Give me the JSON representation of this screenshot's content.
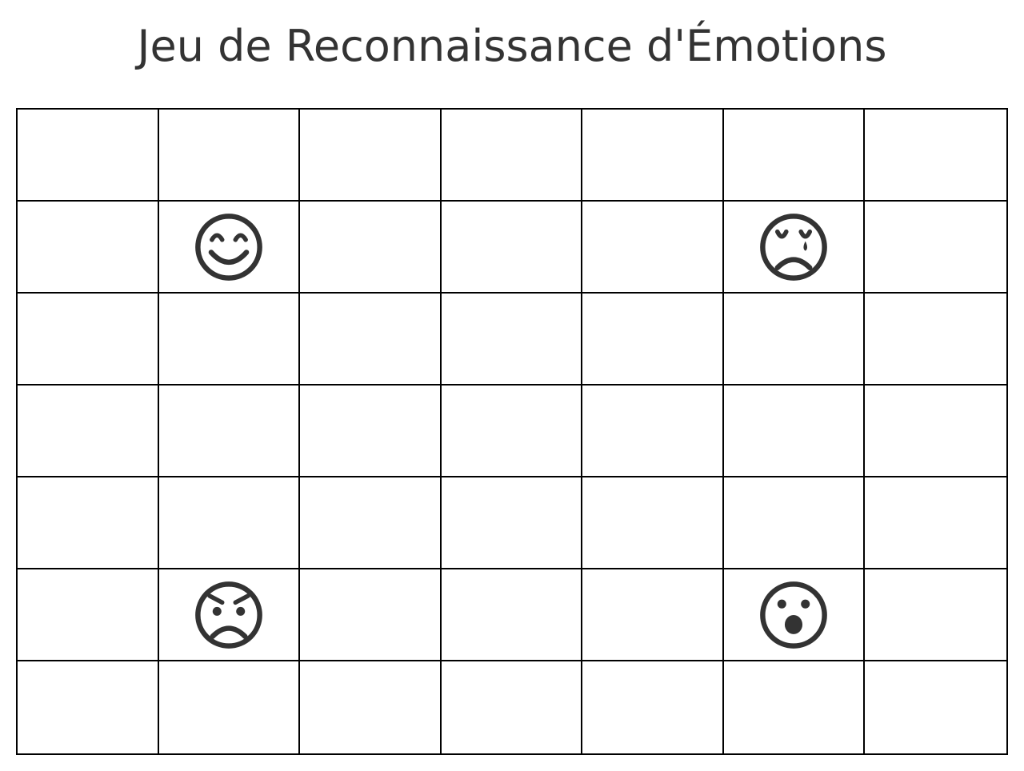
{
  "title": "Jeu de Reconnaissance d'Émotions",
  "grid": {
    "rows": 7,
    "cols": 7
  },
  "colors": {
    "text": "#333333",
    "grid_line": "#000000",
    "background": "#ffffff"
  },
  "emotions": [
    {
      "row": 1,
      "col": 1,
      "icon": "smiling-face-icon"
    },
    {
      "row": 1,
      "col": 5,
      "icon": "crying-face-icon"
    },
    {
      "row": 5,
      "col": 1,
      "icon": "angry-face-icon"
    },
    {
      "row": 5,
      "col": 5,
      "icon": "surprised-face-icon"
    }
  ]
}
